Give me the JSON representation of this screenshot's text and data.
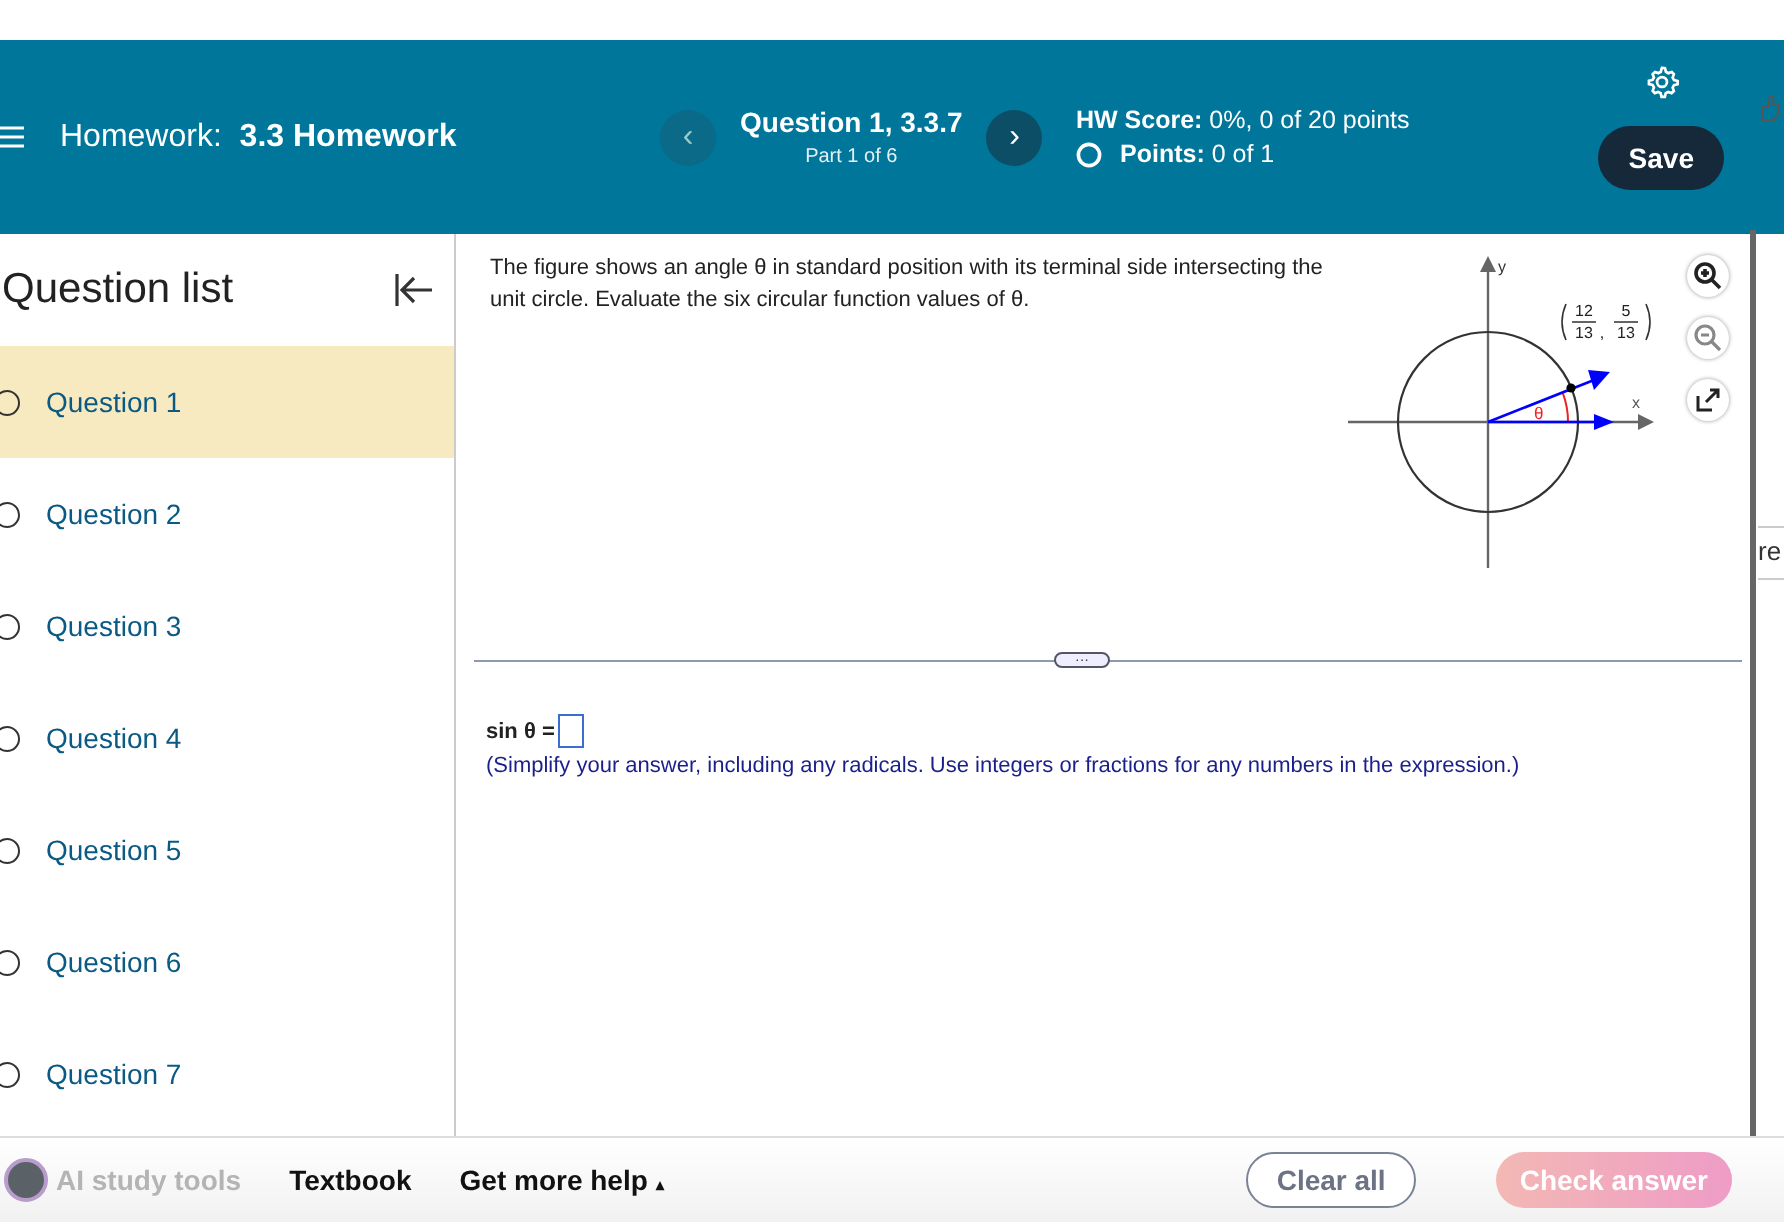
{
  "header": {
    "menu_label": "Homework:",
    "homework": "3.3 Homework",
    "question_title": "Question 1, 3.3.7",
    "part": "Part 1 of 6",
    "prev": "‹",
    "next": "›",
    "hw_score_label": "HW Score:",
    "hw_score": "0%, 0 of 20 points",
    "points_label": "Points:",
    "points": "0 of 1",
    "save": "Save"
  },
  "sidebar": {
    "title": "Question list",
    "items": [
      {
        "label": "Question 1",
        "selected": true
      },
      {
        "label": "Question 2",
        "selected": false
      },
      {
        "label": "Question 3",
        "selected": false
      },
      {
        "label": "Question 4",
        "selected": false
      },
      {
        "label": "Question 5",
        "selected": false
      },
      {
        "label": "Question 6",
        "selected": false
      },
      {
        "label": "Question 7",
        "selected": false
      }
    ]
  },
  "question": {
    "prompt": "The figure shows an angle θ in standard position with its terminal side intersecting the unit circle. Evaluate the six circular function values of θ.",
    "figure": {
      "x_axis": "x",
      "y_axis": "y",
      "angle": "θ",
      "point": {
        "x_num": "12",
        "x_den": "13",
        "separator": ",",
        "y_num": "5",
        "y_den": "13"
      }
    },
    "handle": "···",
    "answer_label": "sin θ =",
    "hint": "(Simplify your answer, including any radicals. Use integers or fractions for any numbers in the expression.)"
  },
  "side_panel": {
    "text": "re"
  },
  "footer": {
    "ai_tools": "AI study tools",
    "ai_disabled": true,
    "textbook": "Textbook",
    "more_help": "Get more help",
    "more_help_caret": "▴",
    "clear": "Clear all",
    "check": "Check answer",
    "check_disabled": true
  }
}
